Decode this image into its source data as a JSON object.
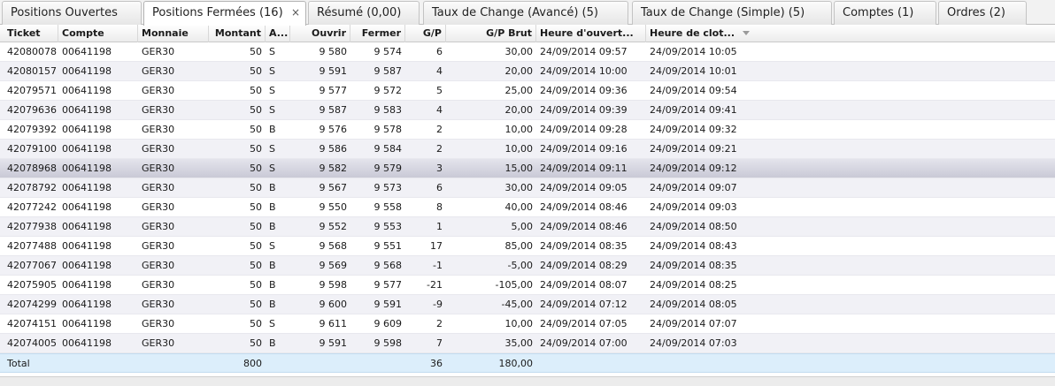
{
  "tabs": [
    {
      "label": "Positions Ouvertes",
      "active": false
    },
    {
      "label": "Positions Fermées (16)",
      "active": true,
      "close_icon": "×"
    },
    {
      "label": "Résumé (0,00)",
      "active": false
    },
    {
      "label": "Taux de Change (Avancé) (5)",
      "active": false
    },
    {
      "label": "Taux de Change (Simple) (5)",
      "active": false
    },
    {
      "label": "Comptes (1)",
      "active": false
    },
    {
      "label": "Ordres (2)",
      "active": false
    }
  ],
  "columns": [
    "Ticket",
    "Compte",
    "Monnaie",
    "Montant",
    "A...",
    "Ouvrir",
    "Fermer",
    "G/P",
    "G/P Brut",
    "Heure d'ouvert...",
    "Heure de clot..."
  ],
  "rows": [
    [
      "42080078",
      "00641198",
      "GER30",
      "50",
      "S",
      "9 580",
      "9 574",
      "6",
      "30,00",
      "24/09/2014 09:57",
      "24/09/2014 10:05"
    ],
    [
      "42080157",
      "00641198",
      "GER30",
      "50",
      "S",
      "9 591",
      "9 587",
      "4",
      "20,00",
      "24/09/2014 10:00",
      "24/09/2014 10:01"
    ],
    [
      "42079571",
      "00641198",
      "GER30",
      "50",
      "S",
      "9 577",
      "9 572",
      "5",
      "25,00",
      "24/09/2014 09:36",
      "24/09/2014 09:54"
    ],
    [
      "42079636",
      "00641198",
      "GER30",
      "50",
      "S",
      "9 587",
      "9 583",
      "4",
      "20,00",
      "24/09/2014 09:39",
      "24/09/2014 09:41"
    ],
    [
      "42079392",
      "00641198",
      "GER30",
      "50",
      "B",
      "9 576",
      "9 578",
      "2",
      "10,00",
      "24/09/2014 09:28",
      "24/09/2014 09:32"
    ],
    [
      "42079100",
      "00641198",
      "GER30",
      "50",
      "S",
      "9 586",
      "9 584",
      "2",
      "10,00",
      "24/09/2014 09:16",
      "24/09/2014 09:21"
    ],
    [
      "42078968",
      "00641198",
      "GER30",
      "50",
      "S",
      "9 582",
      "9 579",
      "3",
      "15,00",
      "24/09/2014 09:11",
      "24/09/2014 09:12"
    ],
    [
      "42078792",
      "00641198",
      "GER30",
      "50",
      "B",
      "9 567",
      "9 573",
      "6",
      "30,00",
      "24/09/2014 09:05",
      "24/09/2014 09:07"
    ],
    [
      "42077242",
      "00641198",
      "GER30",
      "50",
      "B",
      "9 550",
      "9 558",
      "8",
      "40,00",
      "24/09/2014 08:46",
      "24/09/2014 09:03"
    ],
    [
      "42077938",
      "00641198",
      "GER30",
      "50",
      "B",
      "9 552",
      "9 553",
      "1",
      "5,00",
      "24/09/2014 08:46",
      "24/09/2014 08:50"
    ],
    [
      "42077488",
      "00641198",
      "GER30",
      "50",
      "S",
      "9 568",
      "9 551",
      "17",
      "85,00",
      "24/09/2014 08:35",
      "24/09/2014 08:43"
    ],
    [
      "42077067",
      "00641198",
      "GER30",
      "50",
      "B",
      "9 569",
      "9 568",
      "-1",
      "-5,00",
      "24/09/2014 08:29",
      "24/09/2014 08:35"
    ],
    [
      "42075905",
      "00641198",
      "GER30",
      "50",
      "B",
      "9 598",
      "9 577",
      "-21",
      "-105,00",
      "24/09/2014 08:07",
      "24/09/2014 08:25"
    ],
    [
      "42074299",
      "00641198",
      "GER30",
      "50",
      "B",
      "9 600",
      "9 591",
      "-9",
      "-45,00",
      "24/09/2014 07:12",
      "24/09/2014 08:05"
    ],
    [
      "42074151",
      "00641198",
      "GER30",
      "50",
      "S",
      "9 611",
      "9 609",
      "2",
      "10,00",
      "24/09/2014 07:05",
      "24/09/2014 07:07"
    ],
    [
      "42074005",
      "00641198",
      "GER30",
      "50",
      "B",
      "9 591",
      "9 598",
      "7",
      "35,00",
      "24/09/2014 07:00",
      "24/09/2014 07:03"
    ]
  ],
  "selected_row": 6,
  "totals": {
    "label": "Total",
    "amount": "800",
    "gp": "36",
    "gp_brut": "180,00"
  }
}
